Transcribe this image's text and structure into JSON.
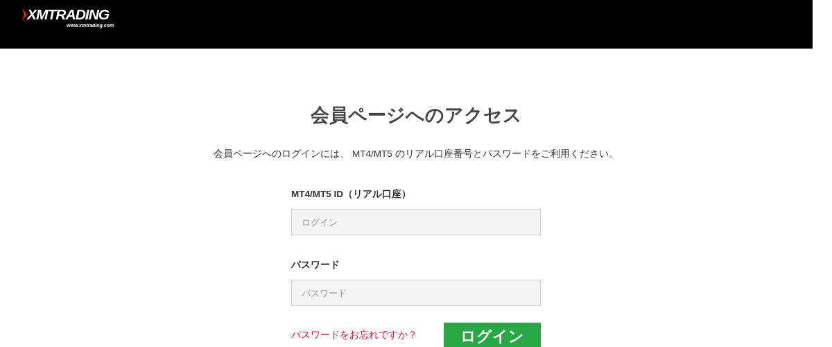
{
  "header": {
    "logo": {
      "name": "XMTRADING",
      "url": "www.xmtrading.com"
    }
  },
  "title": "会員ページへのアクセス",
  "intro": "会員ページへのログインには、 MT4/MT5 のリアル口座番号とパスワードをご利用ください。",
  "fields": [
    {
      "label": "MT4/MT5 ID（リアル口座）",
      "placeholder": "ログイン"
    },
    {
      "label": "パスワード",
      "placeholder": "パスワード"
    }
  ],
  "forgot_link": "パスワードをお忘れですか？",
  "submit_button": "ログイン"
}
